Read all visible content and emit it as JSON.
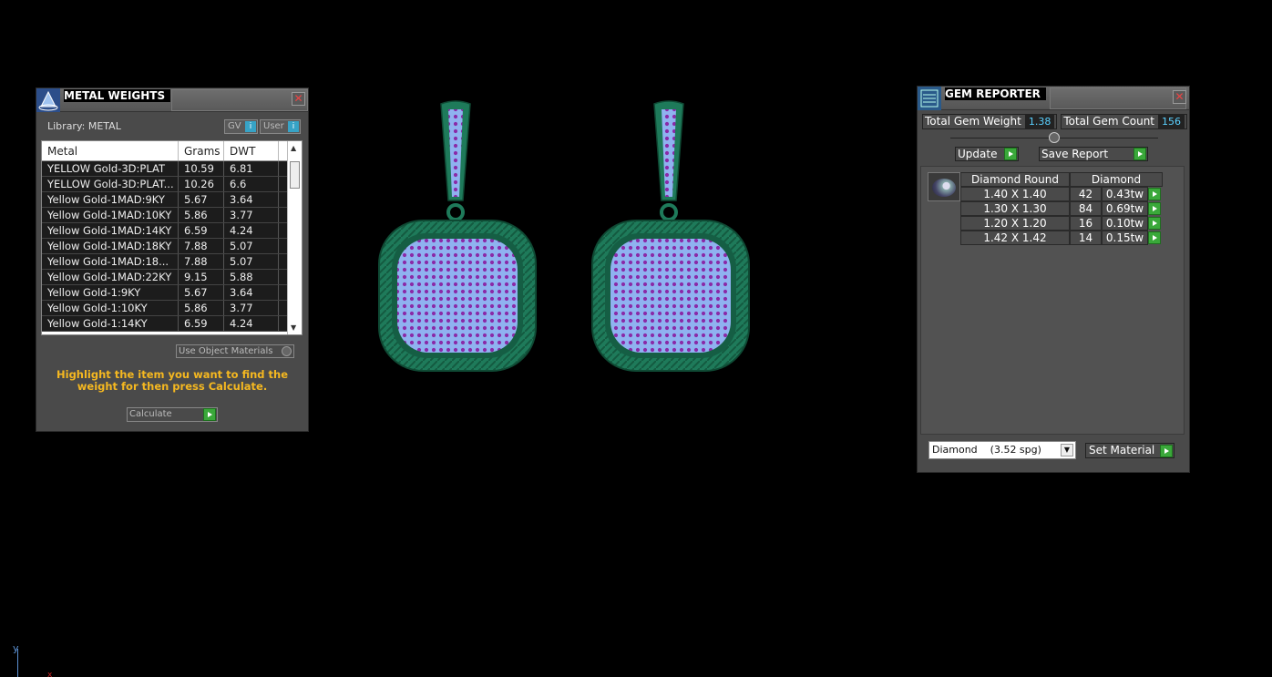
{
  "metal_weights": {
    "title": "METAL WEIGHTS",
    "close_symbol": "✕",
    "library_label": "Library: METAL",
    "gv_label": "GV",
    "user_label": "User",
    "info_symbol": "i",
    "columns": [
      "Metal",
      "Grams",
      "DWT"
    ],
    "rows": [
      {
        "metal": "YELLOW Gold-3D:PLAT",
        "grams": "10.59",
        "dwt": "6.81"
      },
      {
        "metal": "YELLOW Gold-3D:PLAT...",
        "grams": "10.26",
        "dwt": "6.6"
      },
      {
        "metal": "Yellow Gold-1MAD:9KY",
        "grams": "5.67",
        "dwt": "3.64"
      },
      {
        "metal": "Yellow Gold-1MAD:10KY",
        "grams": "5.86",
        "dwt": "3.77"
      },
      {
        "metal": "Yellow Gold-1MAD:14KY",
        "grams": "6.59",
        "dwt": "4.24"
      },
      {
        "metal": "Yellow Gold-1MAD:18KY",
        "grams": "7.88",
        "dwt": "5.07"
      },
      {
        "metal": "Yellow Gold-1MAD:18...",
        "grams": "7.88",
        "dwt": "5.07"
      },
      {
        "metal": "Yellow Gold-1MAD:22KY",
        "grams": "9.15",
        "dwt": "5.88"
      },
      {
        "metal": "Yellow Gold-1:9KY",
        "grams": "5.67",
        "dwt": "3.64"
      },
      {
        "metal": "Yellow Gold-1:10KY",
        "grams": "5.86",
        "dwt": "3.77"
      },
      {
        "metal": "Yellow Gold-1:14KY",
        "grams": "6.59",
        "dwt": "4.24"
      }
    ],
    "use_object_materials": "Use Object Materials",
    "hint": "Highlight the item you want to find the weight for then press Calculate.",
    "calculate_label": "Calculate"
  },
  "gem_reporter": {
    "title": "GEM REPORTER",
    "close_symbol": "✕",
    "total_weight_label": "Total Gem Weight",
    "total_weight_value": "1.38",
    "total_count_label": "Total Gem Count",
    "total_count_value": "156",
    "update_label": "Update",
    "save_report_label": "Save Report",
    "table_header_shape": "Diamond Round",
    "table_header_material": "Diamond",
    "rows": [
      {
        "size": "1.40 X 1.40",
        "count": "42",
        "weight": "0.43tw"
      },
      {
        "size": "1.30 X 1.30",
        "count": "84",
        "weight": "0.69tw"
      },
      {
        "size": "1.20 X 1.20",
        "count": "16",
        "weight": "0.10tw"
      },
      {
        "size": "1.42 X 1.42",
        "count": "14",
        "weight": "0.15tw"
      }
    ],
    "material_select": "Diamond    (3.52 spg)",
    "set_material_label": "Set Material"
  },
  "viewport": {
    "axis_y_label": "y",
    "axis_x_label": "x",
    "metal_color": "#1e7a5a",
    "pave_color": "#8fb2f0",
    "prong_color": "#8a2aa8"
  }
}
